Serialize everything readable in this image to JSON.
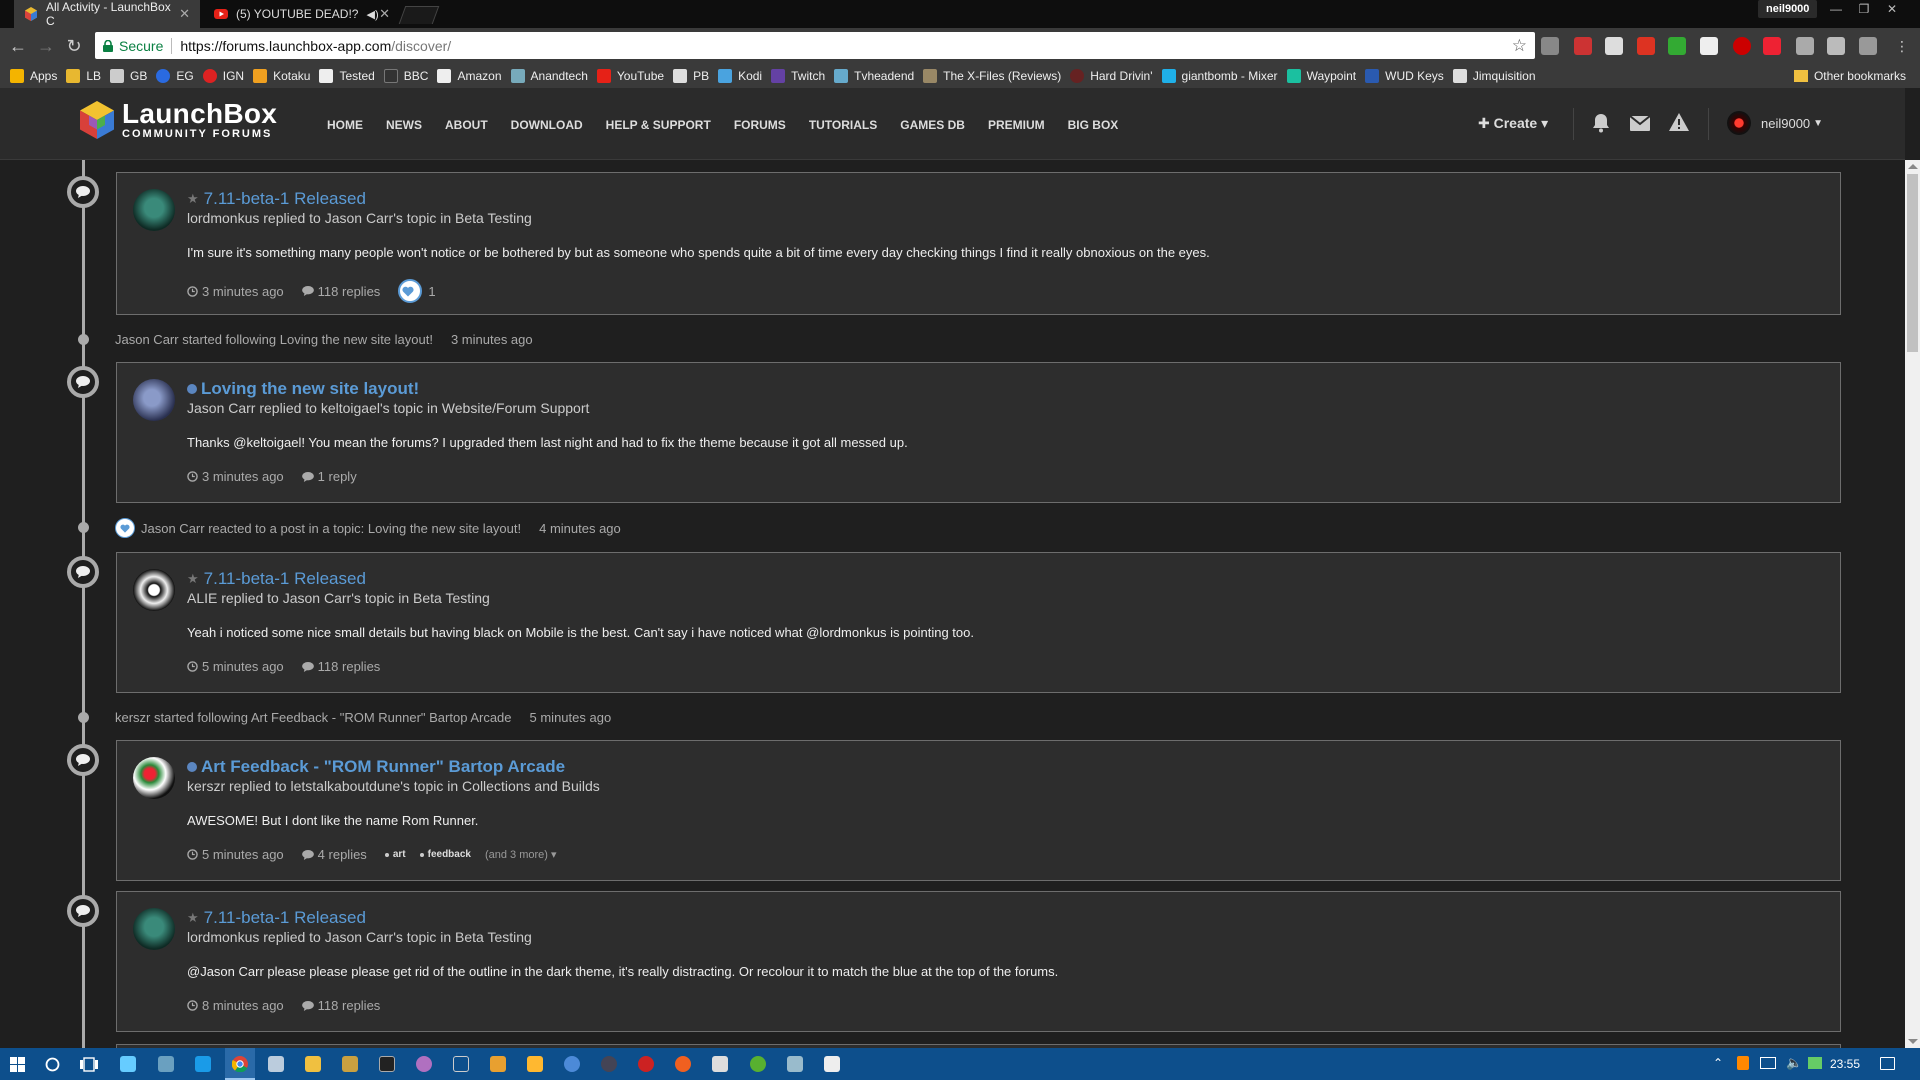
{
  "browser": {
    "tabs": [
      {
        "title": "All Activity - LaunchBox C",
        "active": true
      },
      {
        "title": "(5) YOUTUBE DEAD!?",
        "active": false
      }
    ],
    "window_user": "neil9000",
    "secure_label": "Secure",
    "url_host": "https://forums.launchbox-app.com",
    "url_path": "/discover/",
    "bookmarks": [
      "Apps",
      "LB",
      "GB",
      "EG",
      "IGN",
      "Kotaku",
      "Tested",
      "BBC",
      "Amazon",
      "Anandtech",
      "YouTube",
      "PB",
      "Kodi",
      "Twitch",
      "Tvheadend",
      "The X-Files (Reviews)",
      "Hard Drivin'",
      "giantbomb - Mixer",
      "Waypoint",
      "WUD Keys",
      "Jimquisition"
    ],
    "other_bookmarks": "Other bookmarks"
  },
  "site": {
    "logo_title": "LaunchBox",
    "logo_subtitle": "COMMUNITY FORUMS",
    "nav": [
      "HOME",
      "NEWS",
      "ABOUT",
      "DOWNLOAD",
      "HELP & SUPPORT",
      "FORUMS",
      "TUTORIALS",
      "GAMES DB",
      "PREMIUM",
      "BIG BOX"
    ],
    "create_label": "Create",
    "username": "neil9000"
  },
  "feed": {
    "cards": [
      {
        "title": "7.11-beta-1 Released",
        "unread": false,
        "subtitle": "lordmonkus replied to Jason Carr's topic in Beta Testing",
        "body": "I'm sure it's something many people won't notice or be bothered by but as someone who spends quite a bit of time every day checking things I find it really obnoxious on the eyes.",
        "time": "3 minutes ago",
        "replies": "118 replies",
        "reactions": "1"
      },
      {
        "title": "Loving the new site layout!",
        "unread": true,
        "subtitle": "Jason Carr replied to keltoigael's topic in Website/Forum Support",
        "body": "Thanks @keltoigael! You mean the forums? I upgraded them last night and had to fix the theme because it got all messed up.",
        "time": "3 minutes ago",
        "replies": "1 reply"
      },
      {
        "title": "7.11-beta-1 Released",
        "unread": false,
        "subtitle": "ALIE replied to Jason Carr's topic in Beta Testing",
        "body": "Yeah i noticed some nice small details but having black on Mobile is the best. Can't say i have noticed what @lordmonkus is pointing too.",
        "time": "5 minutes ago",
        "replies": "118 replies"
      },
      {
        "title": "Art Feedback - \"ROM Runner\" Bartop Arcade",
        "unread": true,
        "subtitle": "kerszr replied to letstalkaboutdune's topic in Collections and Builds",
        "body": "AWESOME! But I dont like the name Rom Runner.",
        "time": "5 minutes ago",
        "replies": "4 replies",
        "tags": [
          "art",
          "feedback"
        ],
        "more_tags": "(and 3 more)"
      },
      {
        "title": "7.11-beta-1 Released",
        "unread": false,
        "subtitle": "lordmonkus replied to Jason Carr's topic in Beta Testing",
        "body": "@Jason Carr please please please get rid of the outline in the dark theme, it's really distracting. Or recolour it to match the blue at the top of the forums.",
        "time": "8 minutes ago",
        "replies": "118 replies"
      }
    ],
    "activities": [
      {
        "text": "Jason Carr started following Loving the new site layout!",
        "time": "3 minutes ago"
      },
      {
        "text": "Jason Carr reacted to a post in a topic: Loving the new site layout!",
        "time": "4 minutes ago"
      },
      {
        "text": "kerszr started following Art Feedback - \"ROM Runner\" Bartop Arcade",
        "time": "5 minutes ago"
      }
    ]
  },
  "taskbar": {
    "clock": "23:55"
  }
}
